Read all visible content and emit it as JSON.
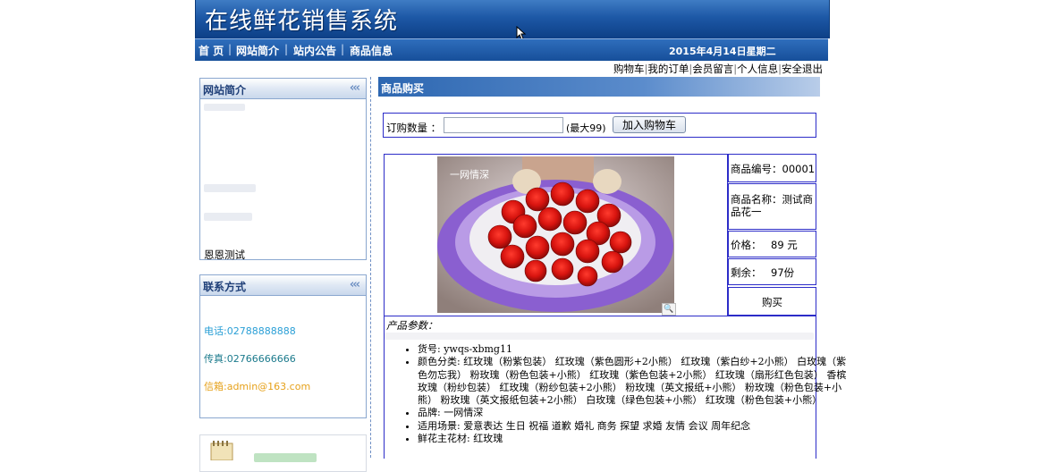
{
  "header": {
    "title": "在线鲜花销售系统",
    "nav": [
      {
        "label": "首 页"
      },
      {
        "label": "网站简介"
      },
      {
        "label": "站内公告"
      },
      {
        "label": "商品信息"
      }
    ],
    "separator": "|",
    "date": "2015年4月14日星期二"
  },
  "user_links": [
    "购物车",
    "我的订单",
    "会员留言",
    "个人信息",
    "安全退出"
  ],
  "sidebar": {
    "intro": {
      "title": "网站简介",
      "arrows": "‹‹‹",
      "text": "恩恩测试"
    },
    "contact": {
      "title": "联系方式",
      "arrows": "‹‹‹",
      "phone": "电话:02788888888",
      "fax": "传真:02766666666",
      "email": "信箱:admin@163.com",
      "phone_color": "#2a9fd6",
      "fax_color": "#1b7a8c",
      "email_color": "#e6a11a"
    }
  },
  "main": {
    "title": "商品购买",
    "order": {
      "qty_label": "订购数量 ：",
      "qty_value": "",
      "qty_max": "(最大99)",
      "add_button": "加入购物车"
    },
    "product": {
      "image_watermark": "一网情深",
      "code": "商品编号：00001",
      "name": "商品名称：测试商品花一",
      "price_label": "价格：",
      "price_value": "89 元",
      "stock_label": "剩余：",
      "stock_value": "97份",
      "buy_label": "购买"
    },
    "params": {
      "title": "产品参数：",
      "items": [
        "货号: ywqs-xbmg11",
        "颜色分类: 红玫瑰（粉紫包装） 红玫瑰（紫色圆形+2小熊） 红玫瑰（紫白纱+2小熊） 白玫瑰（紫色勿忘我） 粉玫瑰（粉色包装+小熊） 红玫瑰（紫色包装+2小熊） 红玫瑰（扇形红色包装） 香槟玫瑰（粉纱包装） 红玫瑰（粉纱包装+2小熊） 粉玫瑰（英文报纸+小熊） 粉玫瑰（粉色包装+小熊） 粉玫瑰（英文报纸包装+2小熊） 白玫瑰（绿色包装+小熊） 红玫瑰（粉色包装+小熊）",
        "品牌: 一网情深",
        "适用场景: 爱意表达 生日 祝福 道歉 婚礼 商务 探望 求婚 友情 会议 周年纪念",
        "鲜花主花材: 红玫瑰"
      ]
    }
  }
}
